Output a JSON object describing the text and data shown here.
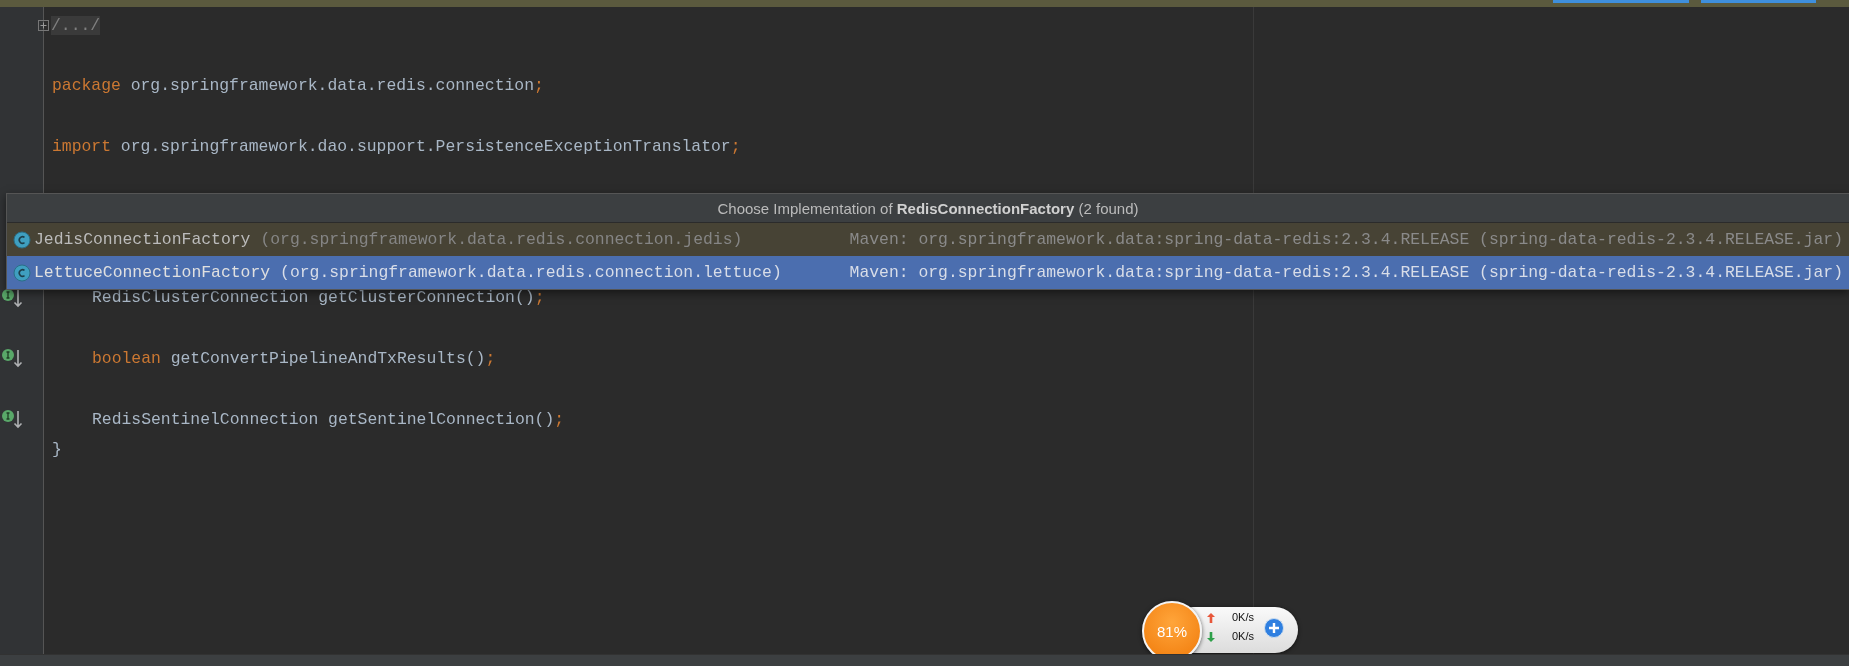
{
  "editor": {
    "lines": [
      {
        "kind": "fold",
        "implemented": false,
        "tokens": [
          {
            "kind": "folded",
            "text": "/.../"
          }
        ]
      },
      {
        "kind": "code",
        "implemented": false,
        "tokens": [
          {
            "kind": "keyword",
            "text": "package"
          },
          {
            "kind": "plain",
            "text": " org.springframework.data.redis.connection"
          },
          {
            "kind": "punct",
            "text": ";"
          }
        ]
      },
      {
        "kind": "code",
        "implemented": false,
        "tokens": [
          {
            "kind": "keyword",
            "text": "import"
          },
          {
            "kind": "plain",
            "text": " org.springframework.dao.support.PersistenceExceptionTranslator"
          },
          {
            "kind": "punct",
            "text": ";"
          }
        ]
      },
      {
        "kind": "member",
        "implemented": true,
        "tokens": [
          {
            "kind": "plain",
            "text": "RedisClusterConnection getClusterConnection()"
          },
          {
            "kind": "punct",
            "text": ";"
          }
        ]
      },
      {
        "kind": "member",
        "implemented": true,
        "tokens": [
          {
            "kind": "keyword",
            "text": "boolean"
          },
          {
            "kind": "plain",
            "text": " getConvertPipelineAndTxResults()"
          },
          {
            "kind": "punct",
            "text": ";"
          }
        ]
      },
      {
        "kind": "member",
        "implemented": true,
        "tokens": [
          {
            "kind": "plain",
            "text": "RedisSentinelConnection getSentinelConnection()"
          },
          {
            "kind": "punct",
            "text": ";"
          }
        ]
      },
      {
        "kind": "code",
        "implemented": false,
        "tokens": [
          {
            "kind": "plain",
            "text": "}"
          }
        ]
      }
    ]
  },
  "popup": {
    "title": "Choose Implementation of **RedisConnectionFactory** (2 found)",
    "items": [
      {
        "name": "JedisConnectionFactory",
        "package": "(org.springframework.data.redis.connection.jedis)",
        "library": "Maven: org.springframework.data:spring-data-redis:2.3.4.RELEASE (spring-data-redis-2.3.4.RELEASE.jar)",
        "selected": false
      },
      {
        "name": "LettuceConnectionFactory",
        "package": "(org.springframework.data.redis.connection.lettuce)",
        "library": "Maven: org.springframework.data:spring-data-redis:2.3.4.RELEASE (spring-data-redis-2.3.4.RELEASE.jar)",
        "selected": true
      }
    ]
  },
  "network_widget": {
    "percent": "81%",
    "upload": "0K/s",
    "download": "0K/s"
  }
}
